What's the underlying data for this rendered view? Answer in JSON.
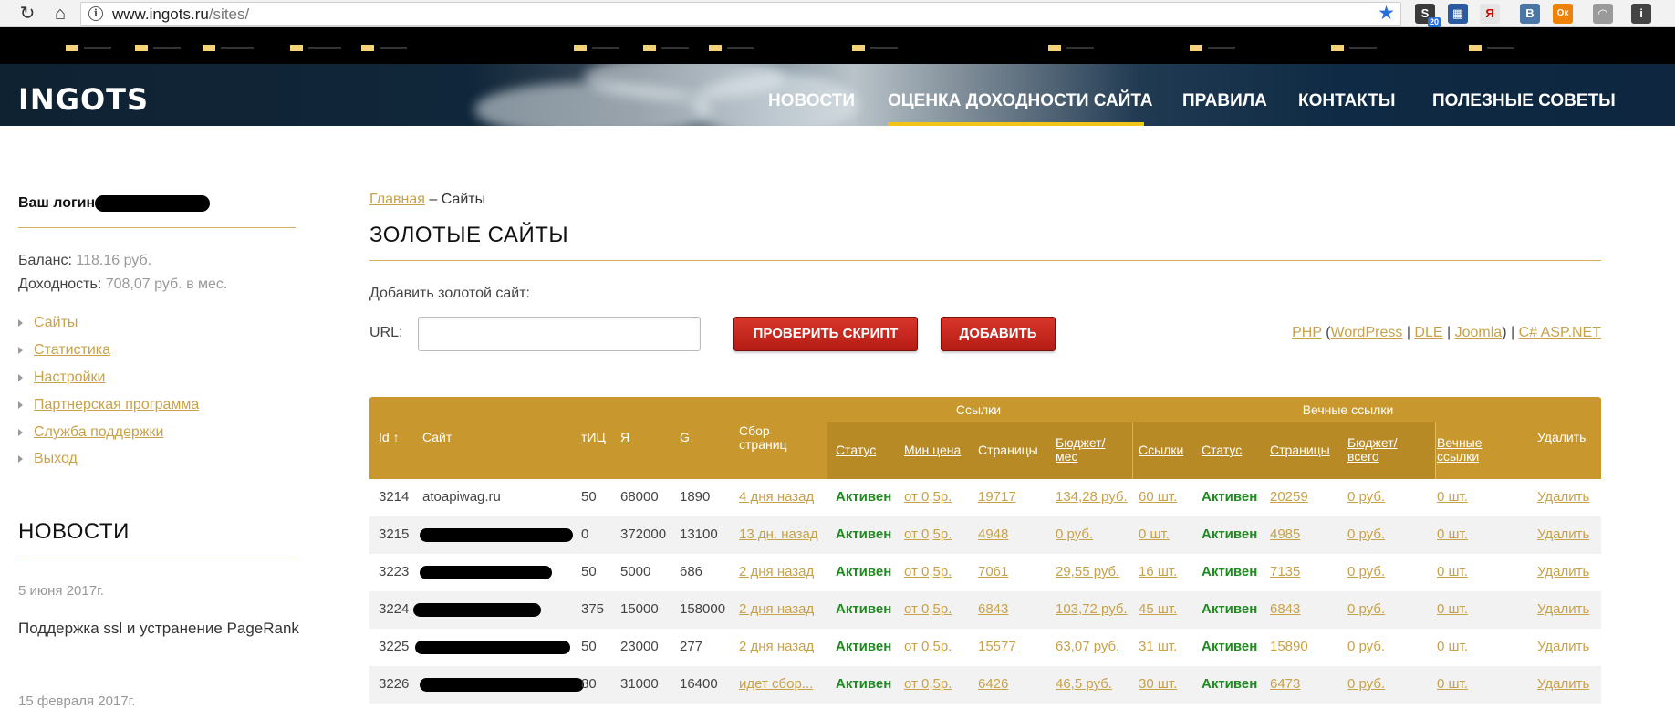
{
  "browser": {
    "url_host": "www.ingots.ru",
    "url_path": "/sites/",
    "ext_badge": "20",
    "ext_letters": [
      "В",
      "Я",
      "Ок"
    ]
  },
  "header": {
    "logo": "INGOTS",
    "nav": [
      "НОВОСТИ",
      "ОЦЕНКА ДОХОДНОСТИ САЙТА",
      "ПРАВИЛА",
      "КОНТАКТЫ",
      "ПОЛЕЗНЫЕ СОВЕТЫ"
    ],
    "active_index": 1
  },
  "sidebar": {
    "login_label": "Ваш логин",
    "balance_label": "Баланс:",
    "balance_value": "118.16 руб.",
    "income_label": "Доходность:",
    "income_value": "708,07 руб. в мес.",
    "menu": [
      "Сайты",
      "Статистика",
      "Настройки",
      "Партнерская программа",
      "Служба поддержки",
      "Выход"
    ],
    "news_title": "НОВОСТИ",
    "news": [
      {
        "date": "5 июня 2017г.",
        "text": "Поддержка ssl и устранение PageRank"
      },
      {
        "date": "15 февраля 2017г.",
        "text": ""
      }
    ]
  },
  "main": {
    "breadcrumb_home": "Главная",
    "breadcrumb_sep": " – ",
    "breadcrumb_current": "Сайты",
    "title": "ЗОЛОТЫЕ САЙТЫ",
    "add_label": "Добавить золотой сайт:",
    "url_label": "URL:",
    "url_value": "",
    "check_button": "ПРОВЕРИТЬ СКРИПТ",
    "add_button": "ДОБАВИТЬ",
    "cms": {
      "php": "PHP",
      "wordpress": "WordPress",
      "dle": "DLE",
      "joomla": "Joomla",
      "aspnet": "C# ASP.NET",
      "open": "(",
      "close": ")",
      "sep": "|"
    }
  },
  "table": {
    "group_links": "Ссылки",
    "group_eternal": "Вечные ссылки",
    "headers": {
      "id": "Id ↑",
      "site": "Сайт",
      "tic": "тИЦ",
      "ya": "Я",
      "g": "G",
      "collect1": "Сбор",
      "collect2": "страниц",
      "status": "Статус",
      "min_price": "Мин.цена",
      "pages": "Страницы",
      "budget1": "Бюджет/",
      "budget2": "мес",
      "links": "Ссылки",
      "e_status": "Статус",
      "e_pages": "Страницы",
      "e_budget1": "Бюджет/",
      "e_budget2": "всего",
      "e_links1": "Вечные",
      "e_links2": "ссылки",
      "delete": "Удалить"
    },
    "rows": [
      {
        "id": "3214",
        "site": "atoapiwag.ru",
        "tic": "50",
        "ya": "68000",
        "g": "1890",
        "collect": "4 дня назад",
        "status": "Активен",
        "min_price": "от 0,5р.",
        "pages": "19717",
        "budget": "134,28 руб.",
        "links": "60 шт.",
        "e_status": "Активен",
        "e_pages": "20259",
        "e_budget": "0 руб.",
        "e_links": "0 шт.",
        "delete": "Удалить"
      },
      {
        "id": "3215",
        "site": "",
        "tic": "0",
        "ya": "372000",
        "g": "13100",
        "collect": "13 дн. назад",
        "status": "Активен",
        "min_price": "от 0,5р.",
        "pages": "4948",
        "budget": "0 руб.",
        "links": "0 шт.",
        "e_status": "Активен",
        "e_pages": "4985",
        "e_budget": "0 руб.",
        "e_links": "0 шт.",
        "delete": "Удалить"
      },
      {
        "id": "3223",
        "site": "",
        "tic": "50",
        "ya": "5000",
        "g": "686",
        "collect": "2 дня назад",
        "status": "Активен",
        "min_price": "от 0,5р.",
        "pages": "7061",
        "budget": "29,55 руб.",
        "links": "16 шт.",
        "e_status": "Активен",
        "e_pages": "7135",
        "e_budget": "0 руб.",
        "e_links": "0 шт.",
        "delete": "Удалить"
      },
      {
        "id": "3224",
        "site": "",
        "tic": "375",
        "ya": "15000",
        "g": "158000",
        "collect": "2 дня назад",
        "status": "Активен",
        "min_price": "от 0,5р.",
        "pages": "6843",
        "budget": "103,72 руб.",
        "links": "45 шт.",
        "e_status": "Активен",
        "e_pages": "6843",
        "e_budget": "0 руб.",
        "e_links": "0 шт.",
        "delete": "Удалить"
      },
      {
        "id": "3225",
        "site": "",
        "tic": "50",
        "ya": "23000",
        "g": "277",
        "collect": "2 дня назад",
        "status": "Активен",
        "min_price": "от 0,5р.",
        "pages": "15577",
        "budget": "63,07 руб.",
        "links": "31 шт.",
        "e_status": "Активен",
        "e_pages": "15890",
        "e_budget": "0 руб.",
        "e_links": "0 шт.",
        "delete": "Удалить"
      },
      {
        "id": "3226",
        "site": "",
        "tic": "80",
        "ya": "31000",
        "g": "16400",
        "collect": "идет сбор...",
        "status": "Активен",
        "min_price": "от 0,5р.",
        "pages": "6426",
        "budget": "46,5 руб.",
        "links": "30 шт.",
        "e_status": "Активен",
        "e_pages": "6473",
        "e_budget": "0 руб.",
        "e_links": "0 шт.",
        "delete": "Удалить"
      }
    ]
  },
  "colors": {
    "gold": "#c8a24a",
    "table_header": "#c8982e",
    "status_active": "#1f8a1f",
    "button_red": "#c62a1f",
    "nav_underline": "#f0c419"
  }
}
